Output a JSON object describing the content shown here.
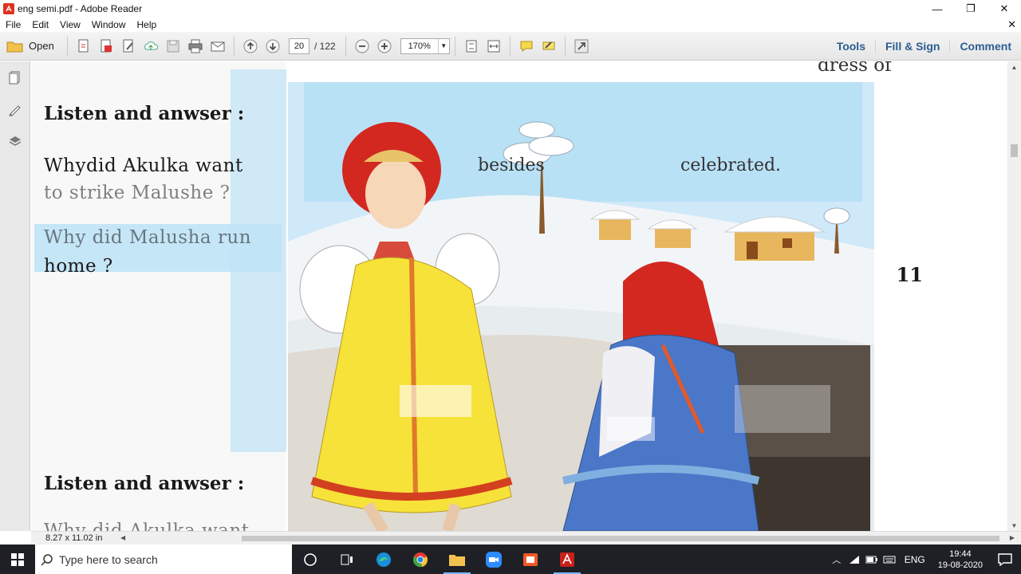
{
  "window": {
    "title": "eng semi.pdf - Adobe Reader",
    "controls": {
      "minimize": "—",
      "restore": "❐",
      "close": "✕"
    }
  },
  "menu": {
    "items": [
      "File",
      "Edit",
      "View",
      "Window",
      "Help"
    ],
    "close_glyph": "✕"
  },
  "toolbar": {
    "open_label": "Open",
    "page_current": "20",
    "page_total": "/ 122",
    "zoom_value": "170%",
    "right_links": [
      "Tools",
      "Fill & Sign",
      "Comment"
    ]
  },
  "document": {
    "heading_1": "Listen and anwser :",
    "question_1_line1": "Whydid Akulka want",
    "question_1_line2": "to strike Malushe ?",
    "question_2_line1": "Why did Malusha run",
    "question_2_line2": "home ?",
    "heading_2": "Listen and anwser :",
    "bottom_partial": "Why did Akulka want",
    "top_right_fragment": "dress of",
    "middle_fragment_1": "besides",
    "middle_fragment_2": "celebrated.",
    "page_number": "11"
  },
  "status": {
    "page_dimensions": "8.27 x 11.02 in"
  },
  "taskbar": {
    "search_placeholder": "Type here to search",
    "language": "ENG",
    "time": "19:44",
    "date": "19-08-2020",
    "apps": [
      "task-view",
      "edge",
      "chrome",
      "file-explorer",
      "zoom",
      "media-app",
      "adobe-reader"
    ]
  },
  "colors": {
    "accent_link": "#2c5e91",
    "taskbar_bg": "#1f2026",
    "adobe_red": "#d32f2f",
    "page_sky": "#bfe3f6"
  }
}
